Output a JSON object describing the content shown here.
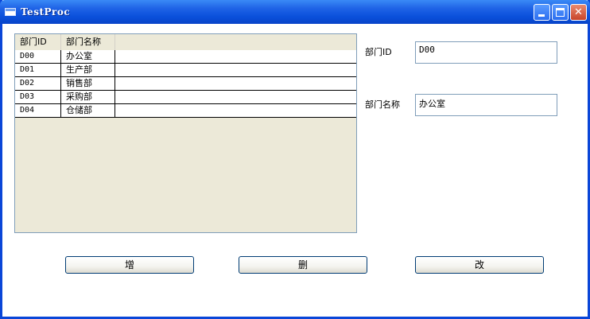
{
  "window": {
    "title": "TestProc"
  },
  "grid": {
    "columns": [
      "部门ID",
      "部门名称"
    ],
    "rows": [
      {
        "id": "D00",
        "name": "办公室"
      },
      {
        "id": "D01",
        "name": "生产部"
      },
      {
        "id": "D02",
        "name": "销售部"
      },
      {
        "id": "D03",
        "name": "采购部"
      },
      {
        "id": "D04",
        "name": "仓储部"
      }
    ]
  },
  "form": {
    "dept_id_label": "部门ID",
    "dept_id_value": "D00",
    "dept_name_label": "部门名称",
    "dept_name_value": "办公室"
  },
  "buttons": {
    "add": "增",
    "delete": "删",
    "edit": "改"
  },
  "colors": {
    "titlebar": "#0a50db",
    "grid_background": "#ece9d8",
    "border": "#7f9db9"
  }
}
